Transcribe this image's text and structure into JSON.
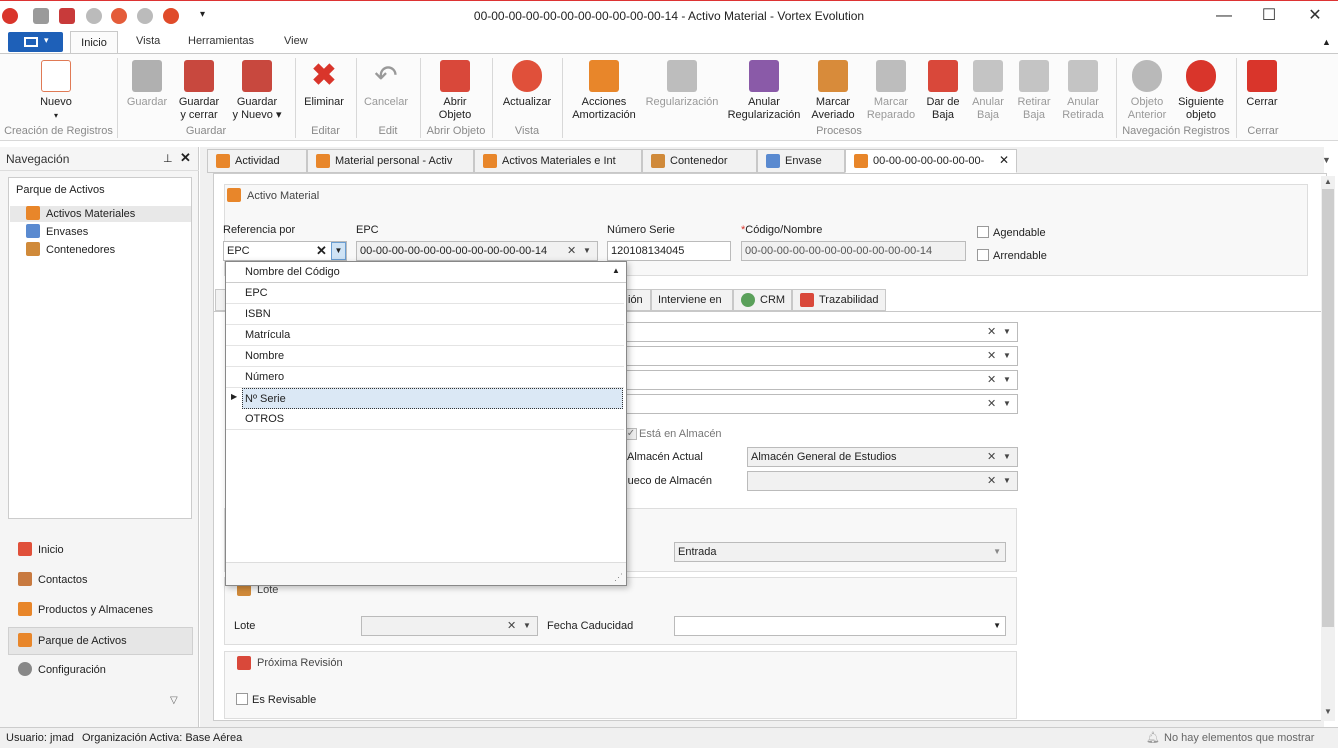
{
  "window": {
    "title": "00-00-00-00-00-00-00-00-00-00-00-14 - Activo Material - Vortex Evolution"
  },
  "ribbon_tabs": [
    "Inicio",
    "Vista",
    "Herramientas",
    "View"
  ],
  "ribbon": {
    "nuevo": "Nuevo",
    "guardar": "Guardar",
    "guardar_cerrar": [
      "Guardar",
      "y cerrar"
    ],
    "guardar_nuevo": [
      "Guardar",
      "y Nuevo"
    ],
    "eliminar": "Eliminar",
    "cancelar": "Cancelar",
    "abrir_objeto": [
      "Abrir",
      "Objeto"
    ],
    "actualizar": "Actualizar",
    "acciones_amortizacion": [
      "Acciones",
      "Amortización"
    ],
    "regularizacion": "Regularización",
    "anular_regularizacion": [
      "Anular",
      "Regularización"
    ],
    "marcar_averiado": [
      "Marcar",
      "Averiado"
    ],
    "marcar_reparado": [
      "Marcar",
      "Reparado"
    ],
    "dar_de_baja": [
      "Dar de",
      "Baja"
    ],
    "anular_baja": [
      "Anular",
      "Baja"
    ],
    "retirar_baja": [
      "Retirar",
      "Baja"
    ],
    "anular_retirada": [
      "Anular",
      "Retirada"
    ],
    "objeto_anterior": [
      "Objeto",
      "Anterior"
    ],
    "siguiente_objeto": [
      "Siguiente",
      "objeto"
    ],
    "cerrar": "Cerrar",
    "groups": {
      "creacion": "Creación de Registros",
      "guardar": "Guardar",
      "editar": "Editar",
      "edit": "Edit",
      "abrir_objeto": "Abrir Objeto",
      "vista": "Vista",
      "procesos": "Procesos",
      "navegacion": "Navegación Registros",
      "cerrar": "Cerrar"
    }
  },
  "nav": {
    "title": "Navegación",
    "section": "Parque de Activos",
    "tree": [
      "Activos Materiales",
      "Envases",
      "Contenedores"
    ],
    "links": [
      "Inicio",
      "Contactos",
      "Productos y Almacenes",
      "Parque de Activos",
      "Configuración"
    ]
  },
  "doc_tabs": [
    "Actividad",
    "Material personal - Activ",
    "Activos Materiales e Int",
    "Contenedor",
    "Envase",
    "00-00-00-00-00-00-00-"
  ],
  "form": {
    "header": "Activo Material",
    "referencia_label": "Referencia por",
    "referencia_value": "EPC",
    "epc_label": "EPC",
    "epc_value": "00-00-00-00-00-00-00-00-00-00-00-14",
    "numero_serie_label": "Número Serie",
    "numero_serie_value": "120108134045",
    "codigo_label": "Código/Nombre",
    "codigo_required": "*",
    "codigo_value": "00-00-00-00-00-00-00-00-00-00-00-14",
    "agendable": "Agendable",
    "arrendable": "Arrendable",
    "subtabs": [
      "ión",
      "Interviene en",
      "CRM",
      "Trazabilidad"
    ],
    "esta_en_almacen": "Está en Almacén",
    "almacen_actual_label": "Almacén Actual",
    "almacen_actual_value": "Almacén General de Estudios",
    "hueco_label": "Hueco de Almacén",
    "entrada_value": "Entrada",
    "lote_header": "Lote",
    "lote_label": "Lote",
    "fecha_caducidad_label": "Fecha Caducidad",
    "proxima_revision_header": "Próxima Revisión",
    "es_revisable": "Es Revisable"
  },
  "dropdown": {
    "header": "Nombre del Código",
    "items": [
      "EPC",
      "ISBN",
      "Matrícula",
      "Nombre",
      "Número",
      "Nº Serie",
      "OTROS"
    ],
    "selected_index": 5
  },
  "status": {
    "usuario": "Usuario: jmad",
    "organizacion": "Organización Activa: Base Aérea",
    "notifications": "No hay elementos que mostrar"
  },
  "colors": {
    "accent": "#1e60b8",
    "red": "#d9352b",
    "orange": "#e8862a",
    "selection": "#dbe8f5"
  }
}
